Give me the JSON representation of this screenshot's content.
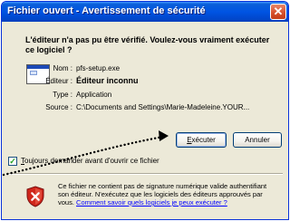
{
  "window": {
    "title": "Fichier ouvert - Avertissement de sécurité",
    "close_symbol": "✕"
  },
  "dialog": {
    "question_line1": "L'éditeur n'a pas pu être vérifié. Voulez-vous vraiment exécuter",
    "question_line2": "ce logiciel ?"
  },
  "file_info": {
    "name_label": "Nom :",
    "name_value": "pfs-setup.exe",
    "publisher_label": "Éditeur :",
    "publisher_value": "Éditeur inconnu",
    "type_label": "Type :",
    "type_value": "Application",
    "source_label": "Source :",
    "source_value": "C:\\Documents and Settings\\Marie-Madeleine.YOUR..."
  },
  "buttons": {
    "execute_accel": "E",
    "execute_rest": "xécuter",
    "cancel_label": "Annuler"
  },
  "checkbox": {
    "checked_symbol": "✓",
    "label_accel": "T",
    "label_rest": "oujours demander avant d'ouvrir ce fichier",
    "checked": true
  },
  "warning": {
    "line1": "Ce fichier ne contient pas de signature numérique valide authentifiant",
    "line2": "son éditeur. N'exécutez que les logiciels des éditeurs approuvés par",
    "line3_prefix": "vous.",
    "link_text": "Comment savoir quels logiciels je peux exécuter ?"
  },
  "colors": {
    "titlebar": "#0054e3",
    "dialog_bg": "#ece9d8",
    "link": "#0000ff",
    "shield_red": "#d0261b",
    "pointer_dots": "#000000"
  }
}
